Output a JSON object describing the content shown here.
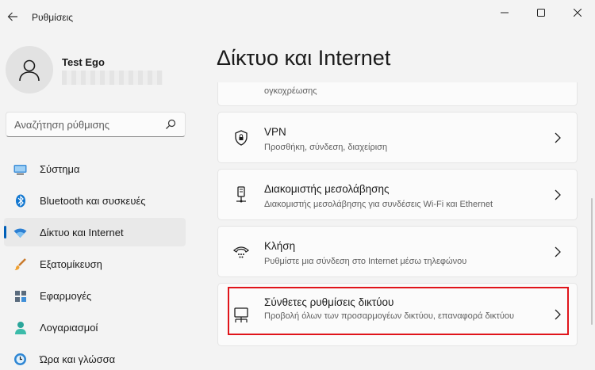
{
  "app": {
    "title": "Ρυθμίσεις"
  },
  "user": {
    "name": "Test Ego"
  },
  "search": {
    "placeholder": "Αναζήτηση ρύθμισης"
  },
  "sidebar": {
    "items": [
      {
        "label": "Σύστημα",
        "icon": "monitor-icon"
      },
      {
        "label": "Bluetooth και συσκευές",
        "icon": "bluetooth-icon"
      },
      {
        "label": "Δίκτυο και Internet",
        "icon": "wifi-icon",
        "active": true
      },
      {
        "label": "Εξατομίκευση",
        "icon": "brush-icon"
      },
      {
        "label": "Εφαρμογές",
        "icon": "apps-icon"
      },
      {
        "label": "Λογαριασμοί",
        "icon": "person-icon"
      },
      {
        "label": "Ώρα και γλώσσα",
        "icon": "clock-globe-icon"
      }
    ]
  },
  "main": {
    "title": "Δίκτυο και Internet",
    "cards": [
      {
        "title": "",
        "subtitle": "ογκοχρέωσης",
        "icon": ""
      },
      {
        "title": "VPN",
        "subtitle": "Προσθήκη, σύνδεση, διαχείριση",
        "icon": "shield-icon"
      },
      {
        "title": "Διακομιστής μεσολάβησης",
        "subtitle": "Διακομιστής μεσολάβησης για συνδέσεις Wi-Fi και Ethernet",
        "icon": "proxy-icon"
      },
      {
        "title": "Κλήση",
        "subtitle": "Ρυθμίστε μια σύνδεση στο Internet μέσω τηλεφώνου",
        "icon": "dialup-icon"
      },
      {
        "title": "Σύνθετες ρυθμίσεις δικτύου",
        "subtitle": "Προβολή όλων των προσαρμογέων δικτύου, επαναφορά δικτύου",
        "icon": "network-pc-icon"
      }
    ]
  },
  "colors": {
    "accent": "#005fb8",
    "highlight": "#e0141a"
  }
}
